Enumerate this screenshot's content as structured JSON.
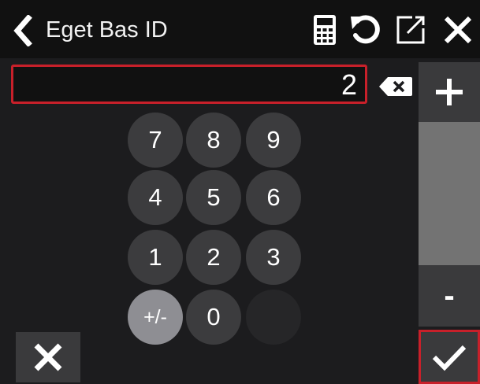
{
  "header": {
    "title": "Eget Bas ID",
    "icons": [
      "back-chevron-icon",
      "calculator-icon",
      "undo-icon",
      "external-open-icon",
      "close-icon"
    ]
  },
  "input": {
    "value": "2"
  },
  "side_controls": {
    "plus_label": "+",
    "minus_label": "-"
  },
  "keypad": {
    "keys": [
      "7",
      "8",
      "9",
      "4",
      "5",
      "6",
      "1",
      "2",
      "3",
      "+/-",
      "0",
      ""
    ]
  },
  "footer": {
    "cancel_icon": "x-icon",
    "confirm_icon": "checkmark-icon"
  },
  "colors": {
    "accent": "#c8202a",
    "background": "#1c1c1e",
    "key": "#3c3c3e",
    "key_light": "#8e8e93",
    "track": "#737373"
  }
}
